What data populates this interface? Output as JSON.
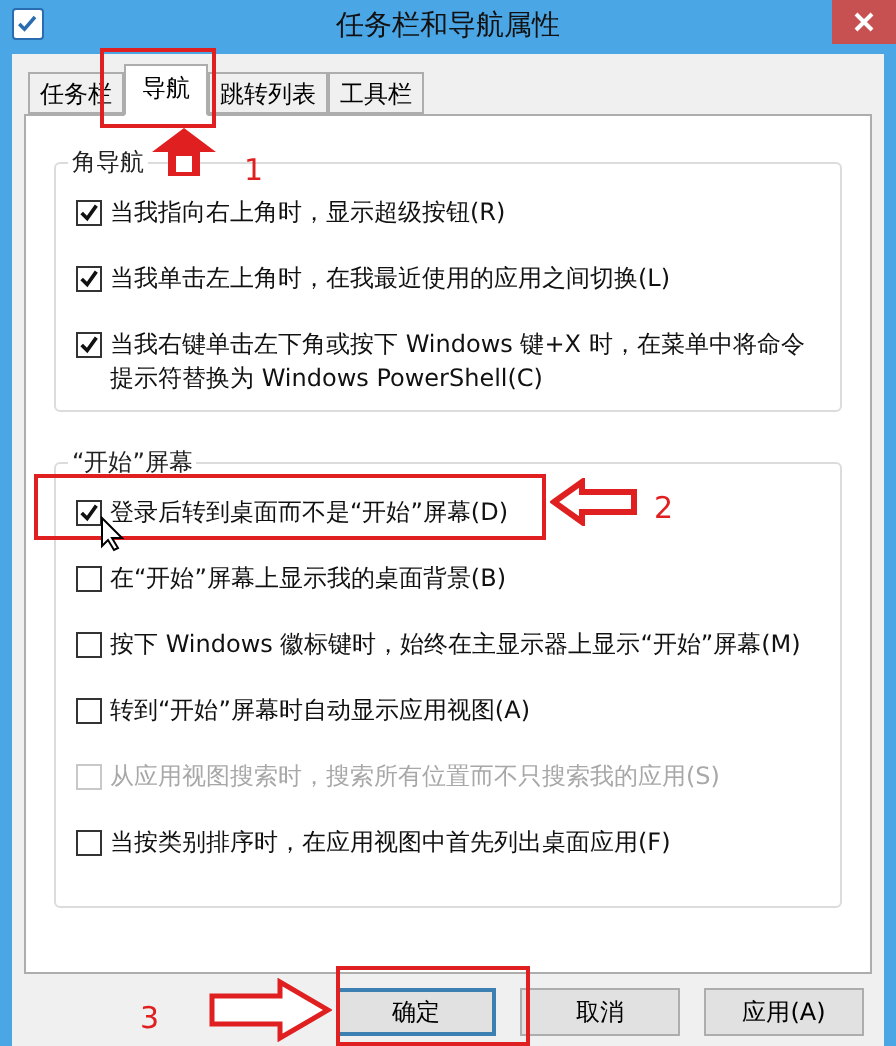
{
  "window": {
    "title": "任务栏和导航属性"
  },
  "tabs": [
    {
      "label": "任务栏",
      "selected": false
    },
    {
      "label": "导航",
      "selected": true
    },
    {
      "label": "跳转列表",
      "selected": false
    },
    {
      "label": "工具栏",
      "selected": false
    }
  ],
  "groups": [
    {
      "title": "角导航",
      "items": [
        {
          "label": "当我指向右上角时，显示超级按钮(R)",
          "checked": true,
          "disabled": false
        },
        {
          "label": "当我单击左上角时，在我最近使用的应用之间切换(L)",
          "checked": true,
          "disabled": false
        },
        {
          "label": "当我右键单击左下角或按下 Windows 键+X 时，在菜单中将命令提示符替换为 Windows PowerShell(C)",
          "checked": true,
          "disabled": false
        }
      ]
    },
    {
      "title": "“开始”屏幕",
      "items": [
        {
          "label": "登录后转到桌面而不是“开始”屏幕(D)",
          "checked": true,
          "disabled": false
        },
        {
          "label": "在“开始”屏幕上显示我的桌面背景(B)",
          "checked": false,
          "disabled": false
        },
        {
          "label": "按下 Windows 徽标键时，始终在主显示器上显示“开始”屏幕(M)",
          "checked": false,
          "disabled": false
        },
        {
          "label": "转到“开始”屏幕时自动显示应用视图(A)",
          "checked": false,
          "disabled": false
        },
        {
          "label": "从应用视图搜索时，搜索所有位置而不只搜索我的应用(S)",
          "checked": false,
          "disabled": true
        },
        {
          "label": "当按类别排序时，在应用视图中首先列出桌面应用(F)",
          "checked": false,
          "disabled": false
        }
      ]
    }
  ],
  "buttons": [
    {
      "label": "确定",
      "default": true
    },
    {
      "label": "取消",
      "default": false
    },
    {
      "label": "应用(A)",
      "default": false
    }
  ],
  "callouts": [
    {
      "number": "1"
    },
    {
      "number": "2"
    },
    {
      "number": "3"
    }
  ]
}
